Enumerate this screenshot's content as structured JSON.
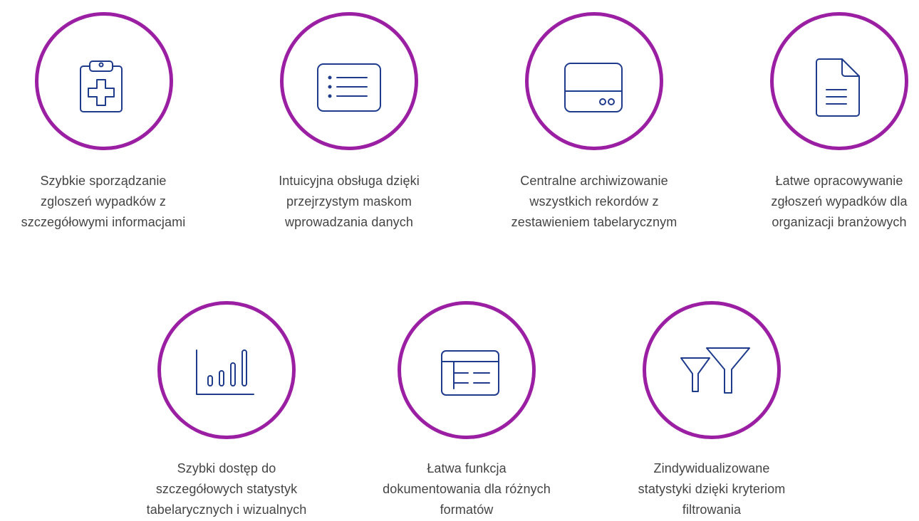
{
  "colors": {
    "ring": "#9b1fa3",
    "icon_stroke": "#1f3b8c",
    "text": "#444444"
  },
  "features": [
    {
      "icon": "clipboard-medical-icon",
      "lines": [
        "Szybkie sporządzanie",
        "zgloszeń wypadków z",
        "szczegółowymi informacjami"
      ]
    },
    {
      "icon": "list-icon",
      "lines": [
        "Intuicyjna obsługa dzięki",
        "przejrzystym maskom",
        "wprowadzania danych"
      ]
    },
    {
      "icon": "server-storage-icon",
      "lines": [
        "Centralne archiwizowanie",
        "wszystkich rekordów z",
        "zestawieniem tabelarycznym"
      ]
    },
    {
      "icon": "document-icon",
      "lines": [
        "Łatwe opracowywanie",
        "zgłoszeń wypadków dla",
        "organizacji branżowych"
      ]
    },
    {
      "icon": "bar-chart-icon",
      "lines": [
        "Szybki dostęp do",
        "szczegółowych statystyk",
        "tabelarycznych i wizualnych"
      ]
    },
    {
      "icon": "table-window-icon",
      "lines": [
        "Łatwa funkcja",
        "dokumentowania dla różnych",
        "formatów"
      ]
    },
    {
      "icon": "filter-funnels-icon",
      "lines": [
        "Zindywidualizowane",
        "statystyki dzięki kryteriom",
        "filtrowania"
      ]
    }
  ]
}
